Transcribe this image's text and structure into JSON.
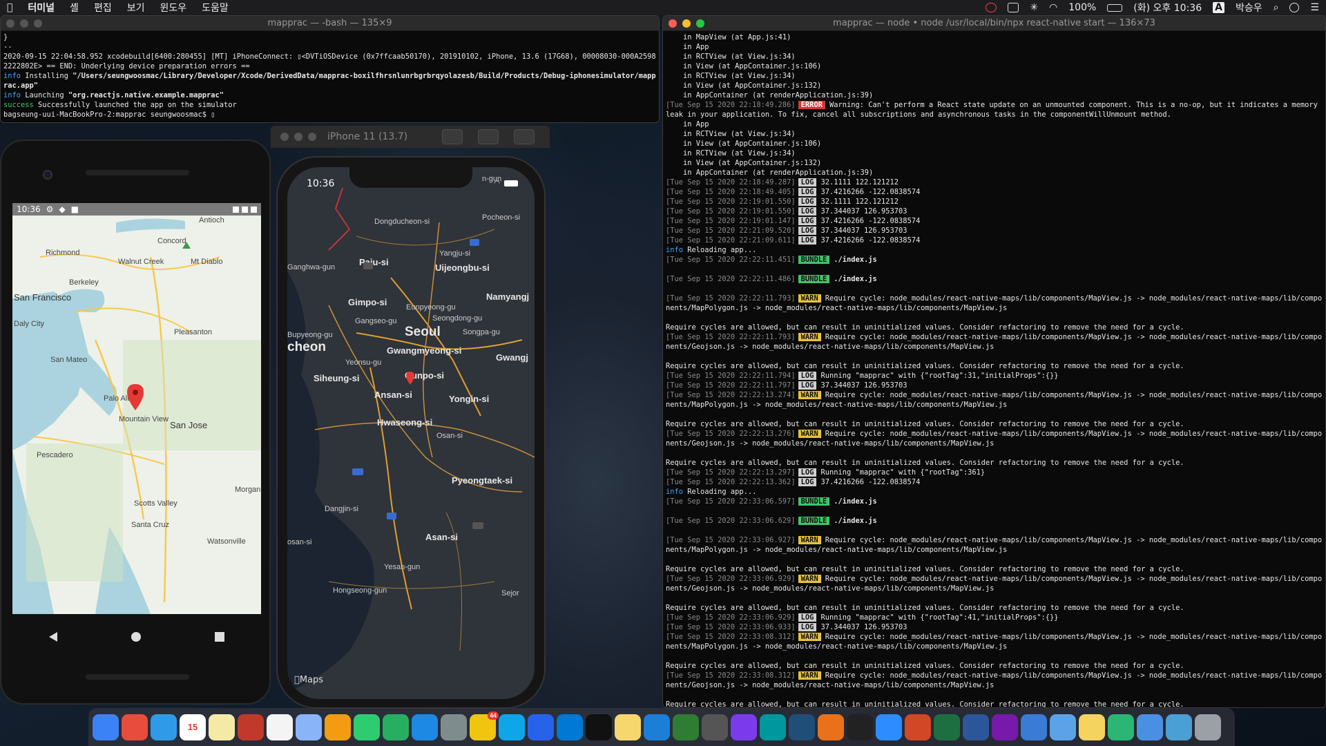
{
  "menubar": {
    "app": "터미널",
    "menus": [
      "셸",
      "편집",
      "보기",
      "윈도우",
      "도움말"
    ],
    "battery": "100%",
    "clock": "(화) 오후 10:36",
    "input_source": "A",
    "user": "박승우"
  },
  "term1": {
    "title": "mapprac — -bash — 135×9",
    "lines": [
      {
        "text": "}"
      },
      {
        "text": "--"
      },
      {
        "text": "2020-09-15 22:04:58.952 xcodebuild[6400:280455] [MT] iPhoneConnect: ▯<DVTiOSDevice (0x7ffcaab50170), 201910102, iPhone, 13.6 (17G68), 00008030-000A25982222802E> == END: Underlying device preparation errors =="
      },
      {
        "prefix": "info",
        "text": " Installing ",
        "bold": "\"/Users/seungwoosmac/Library/Developer/Xcode/DerivedData/mapprac-boxilfhrsnlunrbgrbrqyolazesb/Build/Products/Debug-iphonesimulator/mapprac.app\""
      },
      {
        "prefix": "info",
        "text": " Launching ",
        "bold": "\"org.reactjs.native.example.mapprac\""
      },
      {
        "prefix": "success",
        "text": " Successfully launched the app on the simulator"
      },
      {
        "text": "bagseung-uui-MacBookPro-2:mapprac seungwoosmac$ ▯"
      }
    ]
  },
  "term2": {
    "title": "mapprac — node • node /usr/local/bin/npx react-native start — 136×73",
    "lines": [
      {
        "text": "    in MapView (at App.js:41)"
      },
      {
        "text": "    in App"
      },
      {
        "text": "    in RCTView (at View.js:34)"
      },
      {
        "text": "    in View (at AppContainer.js:106)"
      },
      {
        "text": "    in RCTView (at View.js:34)"
      },
      {
        "text": "    in View (at AppContainer.js:132)"
      },
      {
        "text": "    in AppContainer (at renderApplication.js:39)"
      },
      {
        "ts": "[Tue Sep 15 2020 22:18:49.286]",
        "tag": "ERROR",
        "text": "Warning: Can't perform a React state update on an unmounted component. This is a no-op, but it indicates a memory leak in your application. To fix, cancel all subscriptions and asynchronous tasks in the componentWillUnmount method."
      },
      {
        "text": "    in App"
      },
      {
        "text": "    in RCTView (at View.js:34)"
      },
      {
        "text": "    in View (at AppContainer.js:106)"
      },
      {
        "text": "    in RCTView (at View.js:34)"
      },
      {
        "text": "    in View (at AppContainer.js:132)"
      },
      {
        "text": "    in AppContainer (at renderApplication.js:39)"
      },
      {
        "ts": "[Tue Sep 15 2020 22:18:49.287]",
        "tag": "LOG",
        "text": "32.1111 122.121212"
      },
      {
        "ts": "[Tue Sep 15 2020 22:18:49.405]",
        "tag": "LOG",
        "text": "37.4216266 -122.0838574"
      },
      {
        "ts": "[Tue Sep 15 2020 22:19:01.550]",
        "tag": "LOG",
        "text": "32.1111 122.121212"
      },
      {
        "ts": "[Tue Sep 15 2020 22:19:01.550]",
        "tag": "LOG",
        "text": "37.344037 126.953703"
      },
      {
        "ts": "[Tue Sep 15 2020 22:19:01.147]",
        "tag": "LOG",
        "text": "37.4216266 -122.0838574"
      },
      {
        "ts": "[Tue Sep 15 2020 22:21:09.520]",
        "tag": "LOG",
        "text": "37.344037 126.953703"
      },
      {
        "ts": "[Tue Sep 15 2020 22:21:09.611]",
        "tag": "LOG",
        "text": "37.4216266 -122.0838574"
      },
      {
        "prefix": "info",
        "text": " Reloading app..."
      },
      {
        "ts": "[Tue Sep 15 2020 22:22:11.451]",
        "tag": "BUNDLE",
        "text": "./index.js",
        "boldtext": true
      },
      {
        "text": ""
      },
      {
        "ts": "[Tue Sep 15 2020 22:22:11.486]",
        "tag": "BUNDLE",
        "text": "./index.js",
        "boldtext": true
      },
      {
        "text": ""
      },
      {
        "ts": "[Tue Sep 15 2020 22:22:11.793]",
        "tag": "WARN",
        "text": "Require cycle: node_modules/react-native-maps/lib/components/MapView.js -> node_modules/react-native-maps/lib/components/MapPolygon.js -> node_modules/react-native-maps/lib/components/MapView.js"
      },
      {
        "text": ""
      },
      {
        "text": "Require cycles are allowed, but can result in uninitialized values. Consider refactoring to remove the need for a cycle."
      },
      {
        "ts": "[Tue Sep 15 2020 22:22:11.793]",
        "tag": "WARN",
        "text": "Require cycle: node_modules/react-native-maps/lib/components/MapView.js -> node_modules/react-native-maps/lib/components/Geojson.js -> node_modules/react-native-maps/lib/components/MapView.js"
      },
      {
        "text": ""
      },
      {
        "text": "Require cycles are allowed, but can result in uninitialized values. Consider refactoring to remove the need for a cycle."
      },
      {
        "ts": "[Tue Sep 15 2020 22:22:11.794]",
        "tag": "LOG",
        "text": "Running \"mapprac\" with {\"rootTag\":31,\"initialProps\":{}}"
      },
      {
        "ts": "[Tue Sep 15 2020 22:22:11.797]",
        "tag": "LOG",
        "text": "37.344037 126.953703"
      },
      {
        "ts": "[Tue Sep 15 2020 22:22:13.274]",
        "tag": "WARN",
        "text": "Require cycle: node_modules/react-native-maps/lib/components/MapView.js -> node_modules/react-native-maps/lib/components/MapPolygon.js -> node_modules/react-native-maps/lib/components/MapView.js"
      },
      {
        "text": ""
      },
      {
        "text": "Require cycles are allowed, but can result in uninitialized values. Consider refactoring to remove the need for a cycle."
      },
      {
        "ts": "[Tue Sep 15 2020 22:22:13.276]",
        "tag": "WARN",
        "text": "Require cycle: node_modules/react-native-maps/lib/components/MapView.js -> node_modules/react-native-maps/lib/components/Geojson.js -> node_modules/react-native-maps/lib/components/MapView.js"
      },
      {
        "text": ""
      },
      {
        "text": "Require cycles are allowed, but can result in uninitialized values. Consider refactoring to remove the need for a cycle."
      },
      {
        "ts": "[Tue Sep 15 2020 22:22:13.297]",
        "tag": "LOG",
        "text": "Running \"mapprac\" with {\"rootTag\":361}"
      },
      {
        "ts": "[Tue Sep 15 2020 22:22:13.362]",
        "tag": "LOG",
        "text": "37.4216266 -122.0838574"
      },
      {
        "prefix": "info",
        "text": " Reloading app..."
      },
      {
        "ts": "[Tue Sep 15 2020 22:33:06.597]",
        "tag": "BUNDLE",
        "text": "./index.js",
        "boldtext": true
      },
      {
        "text": ""
      },
      {
        "ts": "[Tue Sep 15 2020 22:33:06.629]",
        "tag": "BUNDLE",
        "text": "./index.js",
        "boldtext": true
      },
      {
        "text": ""
      },
      {
        "ts": "[Tue Sep 15 2020 22:33:06.927]",
        "tag": "WARN",
        "text": "Require cycle: node_modules/react-native-maps/lib/components/MapView.js -> node_modules/react-native-maps/lib/components/MapPolygon.js -> node_modules/react-native-maps/lib/components/MapView.js"
      },
      {
        "text": ""
      },
      {
        "text": "Require cycles are allowed, but can result in uninitialized values. Consider refactoring to remove the need for a cycle."
      },
      {
        "ts": "[Tue Sep 15 2020 22:33:06.929]",
        "tag": "WARN",
        "text": "Require cycle: node_modules/react-native-maps/lib/components/MapView.js -> node_modules/react-native-maps/lib/components/Geojson.js -> node_modules/react-native-maps/lib/components/MapView.js"
      },
      {
        "text": ""
      },
      {
        "text": "Require cycles are allowed, but can result in uninitialized values. Consider refactoring to remove the need for a cycle."
      },
      {
        "ts": "[Tue Sep 15 2020 22:33:06.929]",
        "tag": "LOG",
        "text": "Running \"mapprac\" with {\"rootTag\":41,\"initialProps\":{}}"
      },
      {
        "ts": "[Tue Sep 15 2020 22:33:06.933]",
        "tag": "LOG",
        "text": "37.344037 126.953703"
      },
      {
        "ts": "[Tue Sep 15 2020 22:33:08.312]",
        "tag": "WARN",
        "text": "Require cycle: node_modules/react-native-maps/lib/components/MapView.js -> node_modules/react-native-maps/lib/components/MapPolygon.js -> node_modules/react-native-maps/lib/components/MapView.js"
      },
      {
        "text": ""
      },
      {
        "text": "Require cycles are allowed, but can result in uninitialized values. Consider refactoring to remove the need for a cycle."
      },
      {
        "ts": "[Tue Sep 15 2020 22:33:08.312]",
        "tag": "WARN",
        "text": "Require cycle: node_modules/react-native-maps/lib/components/MapView.js -> node_modules/react-native-maps/lib/components/Geojson.js -> node_modules/react-native-maps/lib/components/MapView.js"
      },
      {
        "text": ""
      },
      {
        "text": "Require cycles are allowed, but can result in uninitialized values. Consider refactoring to remove the need for a cycle."
      }
    ]
  },
  "android": {
    "time": "10:36",
    "map_labels": [
      "Antioch",
      "Concord",
      "Richmond",
      "Walnut Creek",
      "Mt Diablo",
      "Berkeley",
      "San Francisco",
      "Daly City",
      "Pleasanton",
      "San Mateo",
      "Palo Alto",
      "Mountain View",
      "San Jose",
      "Pescadero",
      "Morgan",
      "Scotts Valley",
      "Santa Cruz",
      "Watsonville"
    ]
  },
  "simulator": {
    "title": "iPhone 11 (13.7)",
    "time": "10:36",
    "maps_label": "Maps",
    "map_labels": [
      "Dongducheon-si",
      "Pocheon-si",
      "Paju-si",
      "Yangju-si",
      "Uijeongbu-si",
      "Ganghwa-gun",
      "Gimpo-si",
      "Eunpyeong-gu",
      "Namyangj",
      "Gangseo-gu",
      "Seongdong-gu",
      "Seoul",
      "Songpa-gu",
      "Bupyeong-gu",
      "cheon",
      "Gwangmyeong-si",
      "Gwangj",
      "Yeonsu-gu",
      "Gunpo-si",
      "Siheung-si",
      "Ansan-si",
      "Yongin-si",
      "Hwaseong-si",
      "Osan-si",
      "Pyeongtaek-si",
      "Dangjin-si",
      "Asan-si",
      "Yesan-gun",
      "Hongseong-gun",
      "Sejor",
      "n-gun",
      "osan-si"
    ]
  },
  "dock": {
    "apps": [
      "finder",
      "chrome",
      "safari",
      "calendar",
      "notes",
      "photo-booth",
      "reminders",
      "preview",
      "photos",
      "messages",
      "facetime",
      "app-store",
      "system-preferences",
      "kakaotalk",
      "settings-app",
      "maps",
      "vscode",
      "pycharm",
      "python",
      "xcode",
      "android-studio",
      "sublime",
      "visual-studio",
      "arduino",
      "wireshark",
      "matlab",
      "terminal",
      "zoom",
      "powerpoint",
      "excel",
      "word",
      "onenote",
      "books",
      "app1",
      "notes-app",
      "app2",
      "app3",
      "downloads",
      "trash"
    ],
    "calendar_day": "15",
    "kakaotalk_badge": "44"
  }
}
